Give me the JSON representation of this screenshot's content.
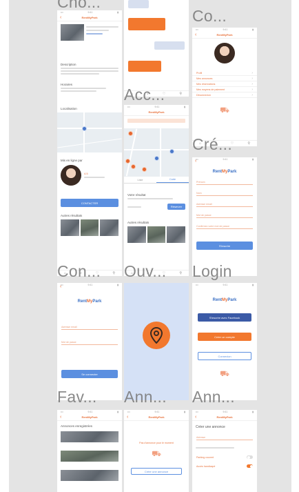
{
  "labels": {
    "cho": "Cho...",
    "acc": "Acc...",
    "co": "Co...",
    "cre": "Cré...",
    "con": "Con...",
    "ouv": "Ouv...",
    "login": "Login",
    "fav": "Fav...",
    "ann1": "Ann...",
    "ann2": "Ann..."
  },
  "brand": {
    "part1": "Rent",
    "part2": "My",
    "part3": "Park"
  },
  "detail": {
    "title": "RentMyPark",
    "description_title": "Description",
    "horaires_title": "Horaires",
    "localisation_title": "Localisation",
    "host_title": "Mis en ligne par",
    "host_rating": "4.5",
    "contact_button": "CONTACTER",
    "others_title": "Autres résultats"
  },
  "map_screen": {
    "title": "RentMyPark",
    "tab_list": "Liste",
    "tab_map": "Carte",
    "result_title": "Votre résultat",
    "button": "Réserver",
    "others_title": "Autres résultats"
  },
  "profile": {
    "title": "RentMyPark",
    "rows": [
      "Profil",
      "Mes annonces",
      "Mes réservations",
      "Mes moyens de paiement",
      "Déconnexion"
    ]
  },
  "create": {
    "fields": [
      "Prénom",
      "Nom",
      "Adresse email",
      "Mot de passe",
      "Confirmez votre mot de passe"
    ],
    "button": "S'inscrire"
  },
  "login_form": {
    "fields": [
      "Adresse email",
      "Mot de passe"
    ],
    "button": "Se connecter"
  },
  "login_choice": {
    "facebook": "S'inscrire avec Facebook",
    "create": "Créer un compte",
    "connect": "Connexion"
  },
  "favorites": {
    "title": "RentMyPark",
    "heading": "Annonces enregistrées"
  },
  "empty_ads": {
    "title": "RentMyPark",
    "message": "Pas d'annonce pour le moment",
    "button": "Créer une annonce"
  },
  "new_ad": {
    "title": "RentMyPark",
    "heading": "Créer une annonce",
    "field": "Adresse",
    "option1": "Parking couvert",
    "option2": "Accès handicapé"
  }
}
